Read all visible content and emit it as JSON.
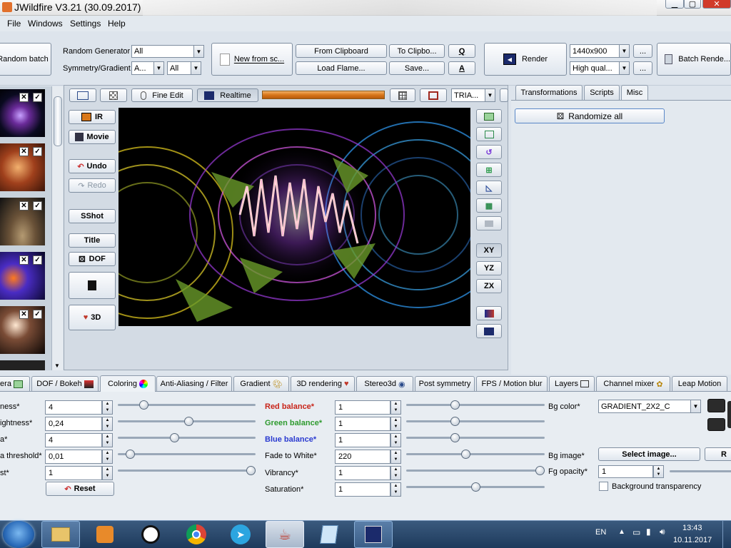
{
  "window": {
    "title": "JWildfire V3.21 (30.09.2017)"
  },
  "menubar": {
    "items": [
      "File",
      "Windows",
      "Settings",
      "Help"
    ]
  },
  "toolbar": {
    "random_batch": "Random batch",
    "random_generator_label": "Random Generator",
    "random_generator_value": "All",
    "symmetry_label": "Symmetry/Gradient",
    "symmetry_value": "A...",
    "gradient_value": "All",
    "new_from_script": "New from sc...",
    "from_clipboard": "From Clipboard",
    "to_clipboard": "To Clipbo...",
    "q_button": "Q",
    "load_flame": "Load Flame...",
    "save": "Save...",
    "a_button": "A",
    "render": "Render",
    "resolution": "1440x900",
    "quality": "High qual...",
    "ellipsis": "...",
    "batch_render": "Batch Rende..."
  },
  "preview_toolbar": {
    "fine_edit": "Fine Edit",
    "realtime": "Realtime",
    "tria": "TRIA..."
  },
  "left_buttons": {
    "ir": "IR",
    "movie": "Movie",
    "undo": "Undo",
    "redo": "Redo",
    "sshot": "SShot",
    "title": "Title",
    "dof": "DOF",
    "threed": "3D"
  },
  "axis_buttons": {
    "xy": "XY",
    "yz": "YZ",
    "zx": "ZX"
  },
  "right_panel": {
    "tabs": [
      "Transformations",
      "Scripts",
      "Misc"
    ],
    "active_tab": "Misc",
    "randomize_all": "Randomize all"
  },
  "bottom_tabs": [
    "era",
    "DOF / Bokeh",
    "Coloring",
    "Anti-Aliasing / Filter",
    "Gradient",
    "3D rendering",
    "Stereo3d",
    "Post symmetry",
    "FPS / Motion blur",
    "Layers",
    "Channel mixer",
    "Leap Motion"
  ],
  "coloring": {
    "col1": [
      {
        "label": "ness*",
        "value": "4",
        "slider": 0.19
      },
      {
        "label": "ightness*",
        "value": "0,24",
        "slider": 0.51
      },
      {
        "label": "a*",
        "value": "4",
        "slider": 0.41
      },
      {
        "label": "a threshold*",
        "value": "0,01",
        "slider": 0.09
      },
      {
        "label": "st*",
        "value": "1",
        "slider": 0.96
      }
    ],
    "reset": "Reset",
    "col2": [
      {
        "label": "Red balance*",
        "value": "1",
        "slider": 0.34,
        "color": "#c8251a"
      },
      {
        "label": "Green balance*",
        "value": "1",
        "slider": 0.34,
        "color": "#2e9a2e"
      },
      {
        "label": "Blue balance*",
        "value": "1",
        "slider": 0.34,
        "color": "#2a3ad0"
      },
      {
        "label": "Fade to White*",
        "value": "220",
        "slider": 0.42,
        "color": "#000000"
      },
      {
        "label": "Vibrancy*",
        "value": "1",
        "slider": 0.96,
        "color": "#000000"
      },
      {
        "label": "Saturation*",
        "value": "1",
        "slider": 0.49,
        "color": "#000000"
      }
    ],
    "bg_color_label": "Bg color*",
    "bg_color_value": "GRADIENT_2X2_C",
    "bg_image_label": "Bg image*",
    "select_image": "Select image...",
    "r_button": "R",
    "fg_opacity_label": "Fg opacity*",
    "fg_opacity_value": "1",
    "bg_transparency": "Background transparency"
  },
  "taskbar": {
    "lang": "EN",
    "time": "13:43",
    "date": "10.11.2017"
  }
}
